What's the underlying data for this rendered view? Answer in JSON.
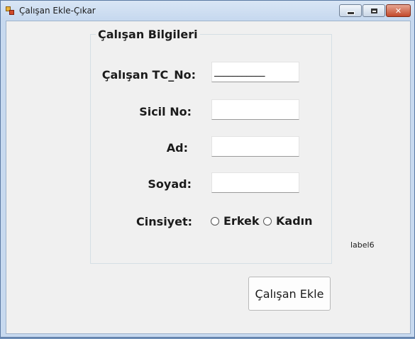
{
  "window": {
    "title": "Çalışan Ekle-Çıkar",
    "controls": {
      "minimize": "minimize",
      "maximize": "maximize",
      "close": "✕"
    }
  },
  "group": {
    "title": "Çalışan Bilgileri",
    "fields": {
      "tc_no": {
        "label": "Çalışan TC_No:",
        "value": "___________"
      },
      "sicil_no": {
        "label": "Sicil No:",
        "value": ""
      },
      "ad": {
        "label": "Ad:",
        "value": ""
      },
      "soyad": {
        "label": "Soyad:",
        "value": ""
      }
    },
    "gender": {
      "label": "Cinsiyet:",
      "options": [
        "Erkek",
        "Kadın"
      ]
    }
  },
  "status_label": "label6",
  "add_button": "Çalışan Ekle",
  "icons": {
    "app": "form-icon",
    "minimize": "minimize-icon",
    "maximize": "maximize-icon",
    "close": "close-icon"
  }
}
